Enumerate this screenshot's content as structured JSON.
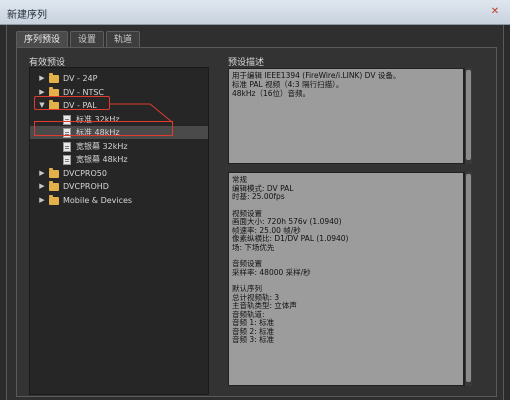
{
  "window": {
    "title": "新建序列",
    "close_glyph": "✕"
  },
  "tabs": [
    {
      "label": "序列预设",
      "active": true
    },
    {
      "label": "设置",
      "active": false
    },
    {
      "label": "轨道",
      "active": false
    }
  ],
  "presets": {
    "label": "有效预设",
    "items": [
      {
        "type": "folder",
        "label": "DV - 24P",
        "expanded": false
      },
      {
        "type": "folder",
        "label": "DV - NTSC",
        "expanded": false
      },
      {
        "type": "folder",
        "label": "DV - PAL",
        "expanded": true
      },
      {
        "type": "file",
        "label": "标准 32kHz"
      },
      {
        "type": "file",
        "label": "标准 48kHz",
        "selected": true
      },
      {
        "type": "file",
        "label": "宽银幕 32kHz"
      },
      {
        "type": "file",
        "label": "宽银幕 48kHz"
      },
      {
        "type": "folder",
        "label": "DVCPRO50",
        "expanded": false
      },
      {
        "type": "folder",
        "label": "DVCPROHD",
        "expanded": false
      },
      {
        "type": "folder",
        "label": "Mobile & Devices",
        "expanded": false
      }
    ]
  },
  "description": {
    "label": "预设描述",
    "lines": [
      "用于编辑 IEEE1394 (FireWire/i.LINK) DV 设备。",
      "标准 PAL 视频（4:3 隔行扫描）。",
      "48kHz（16位）音频。"
    ]
  },
  "general": {
    "lines": [
      "常规",
      "编辑模式: DV PAL",
      "时基: 25.00fps",
      "",
      "视频设置",
      "画面大小: 720h 576v (1.0940)",
      "帧速率: 25.00 帧/秒",
      "像素纵横比: D1/DV PAL (1.0940)",
      "场: 下场优先",
      "",
      "音频设置",
      "采样率: 48000 采样/秒",
      "",
      "默认序列",
      "总计视频轨: 3",
      "主音轨类型: 立体声",
      "音频轨道:",
      "音频 1: 标准",
      "音频 2: 标准",
      "音频 3: 标准"
    ]
  },
  "colors": {
    "highlight_red": "#e23b2e",
    "folder_yellow": "#e3b04a"
  }
}
